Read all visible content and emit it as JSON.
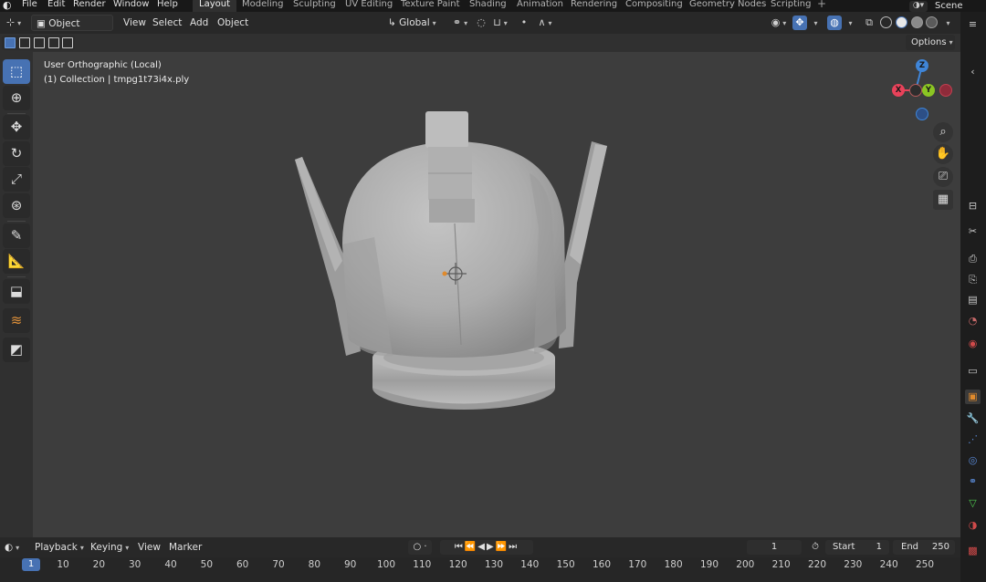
{
  "topbar": {
    "menus": [
      "File",
      "Edit",
      "Render",
      "Window",
      "Help"
    ],
    "workspaces": [
      "Layout",
      "Modeling",
      "Sculpting",
      "UV Editing",
      "Texture Paint",
      "Shading",
      "Animation",
      "Rendering",
      "Compositing",
      "Geometry Nodes",
      "Scripting"
    ],
    "active_workspace": "Layout",
    "add_tab": "+",
    "scene_label": "Scene"
  },
  "viewport_header": {
    "mode": "Object Mode",
    "menus": [
      "View",
      "Select",
      "Add",
      "Object"
    ],
    "orientation": "Global"
  },
  "options_label": "Options",
  "viewport": {
    "view_name": "User Orthographic (Local)",
    "collection_info": "(1) Collection | tmpg1t73i4x.ply"
  },
  "gizmo": {
    "z": "Z",
    "x": "X",
    "y": "Y"
  },
  "timeline": {
    "menus": [
      "Playback",
      "Keying",
      "View",
      "Marker"
    ],
    "current_frame": "1",
    "start_label": "Start",
    "start_value": "1",
    "end_label": "End",
    "end_value": "250",
    "ruler_current": "1",
    "ruler_labels": [
      "10",
      "20",
      "30",
      "40",
      "50",
      "60",
      "70",
      "80",
      "90",
      "100",
      "110",
      "120",
      "130",
      "140",
      "150",
      "160",
      "170",
      "180",
      "190",
      "200",
      "210",
      "220",
      "230",
      "240",
      "250"
    ]
  },
  "colors": {
    "accent": "#4772b3",
    "background": "#303030",
    "axis_x": "#e8425a",
    "axis_y": "#8bc523",
    "axis_z": "#3f85d8"
  },
  "icons": {
    "blender_logo": "blender-logo-icon",
    "zoom": "magnifier-icon",
    "pan": "hand-icon",
    "camera": "camera-icon",
    "grid": "grid-icon"
  }
}
